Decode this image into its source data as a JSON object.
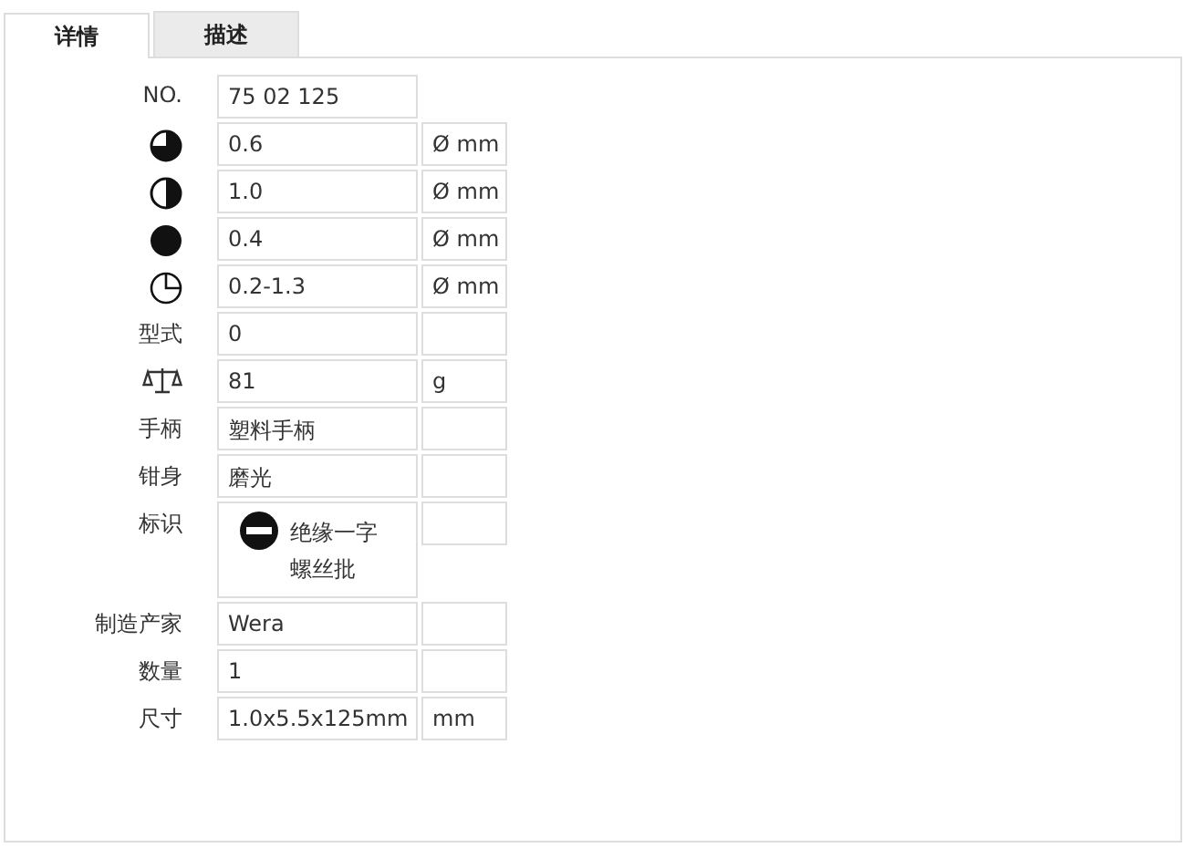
{
  "tabs": [
    {
      "label": "详情",
      "selected": true
    },
    {
      "label": "描述",
      "selected": false
    }
  ],
  "rows": [
    {
      "label": {
        "kind": "text",
        "text": "NO."
      },
      "value": {
        "kind": "text",
        "text": "75 02 125"
      },
      "unit_cell": false
    },
    {
      "label": {
        "kind": "icon"
      },
      "value": {
        "kind": "text",
        "text": "0.6"
      },
      "unit_cell": true,
      "unit": "Ø mm"
    },
    {
      "label": {
        "kind": "icon"
      },
      "value": {
        "kind": "text",
        "text": "1.0"
      },
      "unit_cell": true,
      "unit": "Ø mm"
    },
    {
      "label": {
        "kind": "icon"
      },
      "value": {
        "kind": "text",
        "text": "0.4"
      },
      "unit_cell": true,
      "unit": "Ø mm"
    },
    {
      "label": {
        "kind": "icon"
      },
      "value": {
        "kind": "text",
        "text": "0.2-1.3"
      },
      "unit_cell": true,
      "unit": "Ø mm"
    },
    {
      "label": {
        "kind": "text",
        "text": "型式"
      },
      "value": {
        "kind": "text",
        "text": "0"
      },
      "unit_cell": true
    },
    {
      "label": {
        "kind": "icon"
      },
      "value": {
        "kind": "text",
        "text": "81"
      },
      "unit_cell": true,
      "unit": "g"
    },
    {
      "label": {
        "kind": "text",
        "text": "手柄"
      },
      "value": {
        "kind": "text",
        "text": "塑料手柄"
      },
      "unit_cell": true
    },
    {
      "label": {
        "kind": "text",
        "text": "钳身"
      },
      "value": {
        "kind": "text",
        "text": "磨光"
      },
      "unit_cell": true
    },
    {
      "label": {
        "kind": "text",
        "text": "标识"
      },
      "value": {
        "kind": "icon-text",
        "text": "绝缘一字螺丝批"
      },
      "unit_cell": true
    },
    {
      "label": {
        "kind": "text",
        "text": "制造产家"
      },
      "value": {
        "kind": "text",
        "text": "Wera"
      },
      "unit_cell": true
    },
    {
      "label": {
        "kind": "text",
        "text": "数量"
      },
      "value": {
        "kind": "text",
        "text": "1"
      },
      "unit_cell": true
    },
    {
      "label": {
        "kind": "text",
        "text": "尺寸"
      },
      "value": {
        "kind": "text",
        "text": "1.0x5.5x125mm"
      },
      "unit_cell": true,
      "unit": "mm"
    }
  ]
}
